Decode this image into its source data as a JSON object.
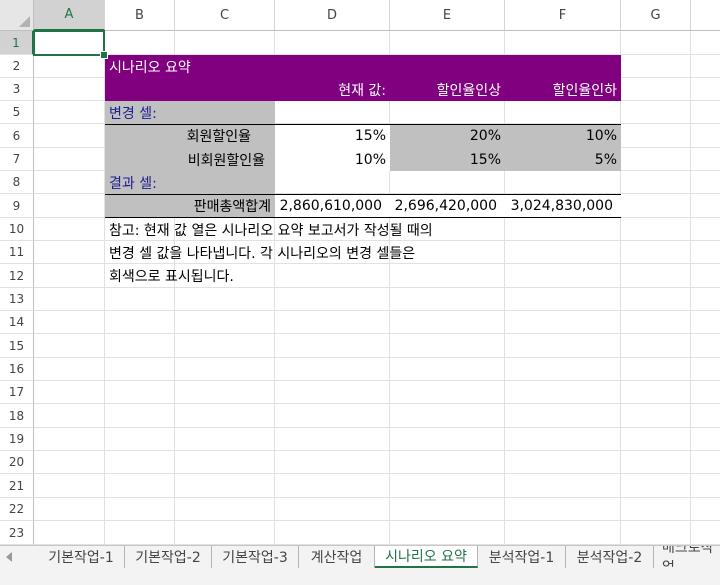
{
  "columns": [
    "A",
    "B",
    "C",
    "D",
    "E",
    "F",
    "G"
  ],
  "rows": [
    "1",
    "2",
    "3",
    "5",
    "6",
    "7",
    "8",
    "9",
    "10",
    "11",
    "12",
    "13",
    "14",
    "15",
    "16",
    "17",
    "18",
    "19",
    "20",
    "21",
    "22",
    "23"
  ],
  "summary": {
    "title": "시나리오 요약",
    "header_current": "현재 값:",
    "header_s1": "할인율인상",
    "header_s2": "할인율인하",
    "changing_cells": "변경 셀:",
    "row1_label": "회원할인율",
    "row1_current": "15%",
    "row1_s1": "20%",
    "row1_s2": "10%",
    "row2_label": "비회원할인율",
    "row2_current": "10%",
    "row2_s1": "15%",
    "row2_s2": "5%",
    "result_cells": "결과 셀:",
    "result_label": "판매총액합계",
    "result_current": "2,860,610,000",
    "result_s1": "2,696,420,000",
    "result_s2": "3,024,830,000",
    "note_line1": "참고: 현재 값 열은 시나리오 요약 보고서가 작성될 때의",
    "note_line2": "변경 셀 값을 나타냅니다. 각 시나리오의 변경 셀들은",
    "note_line3": "회색으로 표시됩니다."
  },
  "tabs": [
    "기본작업-1",
    "기본작업-2",
    "기본작업-3",
    "계산작업",
    "시나리오 요약",
    "분석작업-1",
    "분석작업-2",
    "매크로작업"
  ],
  "active_tab": "시나리오 요약",
  "colors": {
    "accent": "#217346",
    "header_fill": "#800080",
    "changing_fill": "#c0c0c0",
    "label_text": "#1f1f8f"
  }
}
